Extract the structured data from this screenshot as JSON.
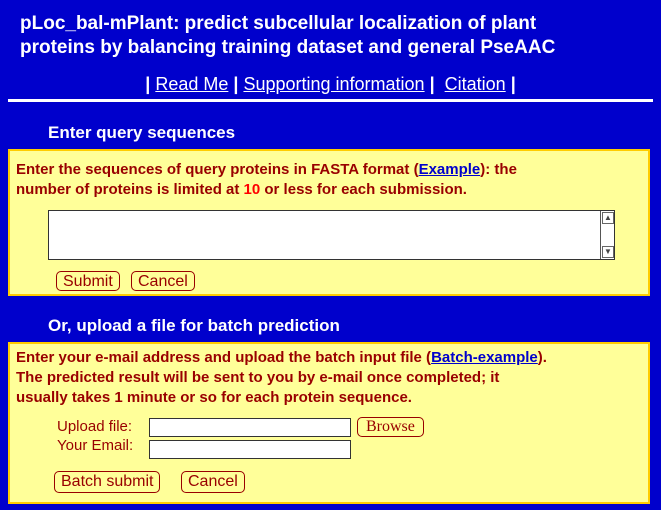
{
  "header": {
    "title_line1": "pLoc_bal-mPlant: predict subcellular localization of plant",
    "title_line2": "proteins by balancing training dataset and general PseAAC",
    "links": [
      {
        "label": "Read Me"
      },
      {
        "label": "Supporting information"
      },
      {
        "label": "Citation"
      }
    ],
    "separator": "|"
  },
  "query_section": {
    "title": "Enter query sequences",
    "instruction_part1": "Enter the sequences of query proteins in FASTA format (",
    "example_link": "Example",
    "instruction_part2": "): the",
    "instruction_line2_part1": "number of proteins is limited at ",
    "limit": "10",
    "instruction_line2_part2": " or less for each submission.",
    "sequence_value": "",
    "submit_label": "Submit",
    "cancel_label": "Cancel"
  },
  "batch_section": {
    "title": "Or, upload a file for batch prediction",
    "instruction_line1_part1": "Enter your e-mail address and upload the batch input file (",
    "batch_example_link": "Batch-example",
    "instruction_line1_part2": ").",
    "instruction_line2": "The predicted result will be sent to you by e-mail once completed; it",
    "instruction_line3": "usually takes 1 minute or so for each protein sequence.",
    "upload_label": "Upload file:",
    "upload_value": "",
    "browse_label": "Browse",
    "email_label": "Your Email:",
    "email_value": "",
    "batch_submit_label": "Batch submit",
    "cancel_label": "Cancel"
  },
  "colors": {
    "background": "#0000cc",
    "panel": "#ffff99",
    "panel_border": "#ffcc00",
    "instruction_text": "#990000",
    "highlight": "#ff0000",
    "link": "#0000cc"
  }
}
